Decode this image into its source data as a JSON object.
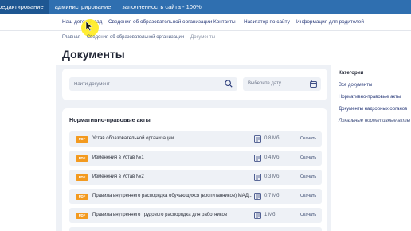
{
  "admin_bar": {
    "items": [
      "редактирование",
      "администрирование",
      "заполненность сайта - 100%"
    ]
  },
  "topnav": {
    "links": [
      "Наш детский сад",
      "Сведения об образовательной организации",
      "Контакты",
      "Навигатор по сайту",
      "Информация для родителей"
    ]
  },
  "breadcrumb": [
    "Главная",
    "Сведения об образовательной организации",
    "Документы"
  ],
  "page_title": "Документы",
  "filters": {
    "search_placeholder": "Найти документ",
    "date_placeholder": "Выберите дату"
  },
  "section": {
    "title": "Нормативно-правовые акты"
  },
  "documents": [
    {
      "badge": "PDF",
      "name": "Устав образовательной организации",
      "size": "0,8 Мб",
      "action": "Скачать"
    },
    {
      "badge": "PDF",
      "name": "Изменения в Устав №1",
      "size": "0,4 Мб",
      "action": "Скачать"
    },
    {
      "badge": "PDF",
      "name": "Изменения в Устав №2",
      "size": "0,3 Мб",
      "action": "Скачать"
    },
    {
      "badge": "PDF",
      "name": "Правила внутреннего распорядка обучающихся (воспитанников) МАД...",
      "size": "0,7 Мб",
      "action": "Скачать"
    },
    {
      "badge": "PDF",
      "name": "Правила внутреннего трудового распорядка для работников",
      "size": "1 Мб",
      "action": "Скачать"
    }
  ],
  "categories": {
    "title": "Категории",
    "items": [
      "Все документы",
      "Нормативно-правовые акты",
      "Документы надзорных органов",
      "Локальные нормативные акты"
    ]
  },
  "colors": {
    "admin_bar": "#2f6fb0",
    "admin_active": "#1e5792",
    "pdf_badge": "#f39a1f",
    "link": "#2a3b7a",
    "card_bg": "#eef1f6",
    "cursor_highlight": "#ffec28"
  },
  "icons": [
    "search-icon",
    "calendar-icon",
    "view-icon",
    "cursor-icon"
  ]
}
